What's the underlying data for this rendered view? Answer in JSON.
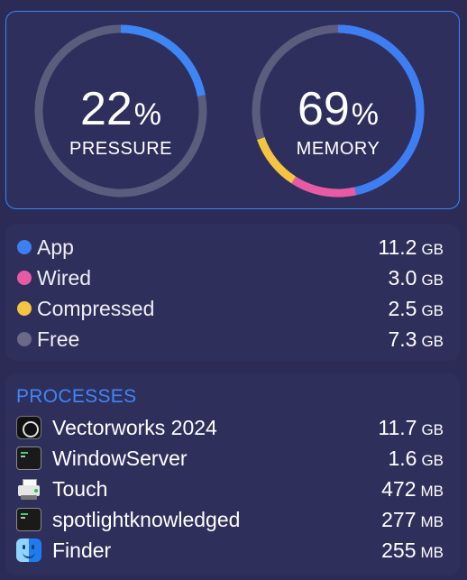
{
  "gauges": {
    "pressure": {
      "value": 22,
      "percent_symbol": "%",
      "label": "PRESSURE",
      "color": "#3d86f6",
      "track_color": "#5c5c7c"
    },
    "memory": {
      "value": 69,
      "percent_symbol": "%",
      "label": "MEMORY",
      "track_color": "#5c5c7c",
      "segments": [
        {
          "name": "App",
          "fraction": 0.466,
          "color": "#3d7ff3"
        },
        {
          "name": "Wired",
          "fraction": 0.125,
          "color": "#e85ba4"
        },
        {
          "name": "Compressed",
          "fraction": 0.104,
          "color": "#f5c542"
        }
      ]
    }
  },
  "memory_breakdown": {
    "items": [
      {
        "name": "App",
        "value": "11.2",
        "unit": "GB",
        "color": "#3d7ff3",
        "icon": "blue-dot"
      },
      {
        "name": "Wired",
        "value": "3.0",
        "unit": "GB",
        "color": "#e85ba4",
        "icon": "pink-dot"
      },
      {
        "name": "Compressed",
        "value": "2.5",
        "unit": "GB",
        "color": "#f5c542",
        "icon": "yellow-dot"
      },
      {
        "name": "Free",
        "value": "7.3",
        "unit": "GB",
        "color": "#6a6a85",
        "icon": "gray-dot"
      }
    ]
  },
  "processes": {
    "title": "PROCESSES",
    "title_color": "#3f86f7",
    "items": [
      {
        "name": "Vectorworks 2024",
        "value": "11.7",
        "unit": "GB",
        "icon": "vectorworks-icon"
      },
      {
        "name": "WindowServer",
        "value": "1.6",
        "unit": "GB",
        "icon": "terminal-icon"
      },
      {
        "name": "Touch",
        "value": "472",
        "unit": "MB",
        "icon": "printer-icon"
      },
      {
        "name": "spotlightknowledged",
        "value": "277",
        "unit": "MB",
        "icon": "terminal-icon"
      },
      {
        "name": "Finder",
        "value": "255",
        "unit": "MB",
        "icon": "finder-icon"
      }
    ]
  }
}
